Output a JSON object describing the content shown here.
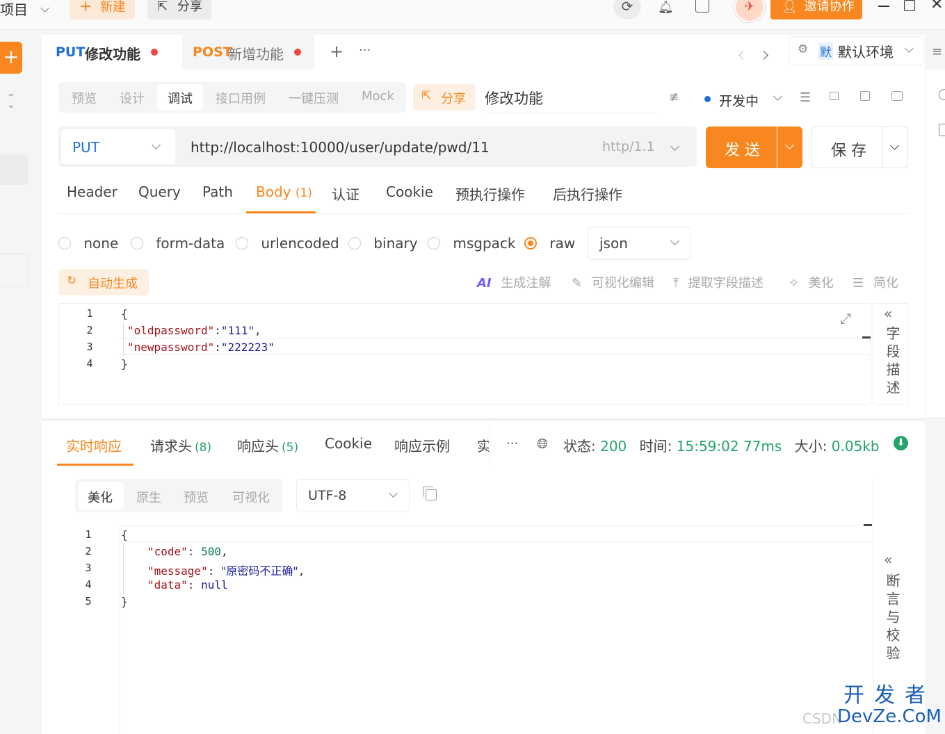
{
  "topbar": {
    "project_label": "项目",
    "new_label": "新建",
    "share_label": "分享",
    "invite_label": "邀请协作"
  },
  "tabs": [
    {
      "method": "PUT",
      "title": "修改功能"
    },
    {
      "method": "POST",
      "title": "新增功能"
    }
  ],
  "env": {
    "badge": "默",
    "label": "默认环境"
  },
  "mode_tabs": [
    "预览",
    "设计",
    "调试",
    "接口用例",
    "一键压测",
    "Mock"
  ],
  "active_mode": "调试",
  "share_button": "分享",
  "api_name": "修改功能",
  "status": "开发中",
  "request": {
    "method": "PUT",
    "url": "http://localhost:10000/user/update/pwd/11",
    "protocol": "http/1.1",
    "send_label": "发 送",
    "save_label": "保 存"
  },
  "param_tabs": {
    "header": "Header",
    "query": "Query",
    "path": "Path",
    "body": "Body",
    "body_count": "(1)",
    "auth": "认证",
    "cookie": "Cookie",
    "pre": "预执行操作",
    "post": "后执行操作"
  },
  "body_types": {
    "none": "none",
    "form_data": "form-data",
    "urlencoded": "urlencoded",
    "binary": "binary",
    "msgpack": "msgpack",
    "raw": "raw",
    "format": "json"
  },
  "tools": {
    "auto_gen": "自动生成",
    "ai": "AI",
    "gen_comment": "生成注解",
    "visual_edit": "可视化编辑",
    "extract": "提取字段描述",
    "beautify": "美化",
    "simplify": "简化"
  },
  "request_body": {
    "line_numbers": [
      "1",
      "2",
      "3",
      "4"
    ],
    "open": "{",
    "fields": [
      {
        "key": "\"oldpassword\"",
        "sep": ":",
        "value": "\"111\"",
        "tail": ","
      },
      {
        "key": "\"newpassword\"",
        "sep": ":",
        "value": "\"222223\"",
        "tail": ""
      }
    ],
    "close": "}"
  },
  "field_desc_label": "字段描述",
  "response_tabs": {
    "realtime": "实时响应",
    "req_headers": "请求头",
    "req_headers_count": "(8)",
    "resp_headers": "响应头",
    "resp_headers_count": "(5)",
    "cookie": "Cookie",
    "example": "响应示例",
    "more_cut": "实",
    "ellipsis": "···"
  },
  "response_meta": {
    "status_label": "状态:",
    "status_value": "200",
    "time_label": "时间:",
    "time_value": "15:59:02",
    "duration": "77ms",
    "size_label": "大小:",
    "size_value": "0.05kb"
  },
  "view_tabs": [
    "美化",
    "原生",
    "预览",
    "可视化"
  ],
  "encoding": "UTF-8",
  "response_body": {
    "line_numbers": [
      "1",
      "2",
      "3",
      "4",
      "5"
    ],
    "open": "{",
    "fields": [
      {
        "key": "\"code\"",
        "sep": ": ",
        "value": "500",
        "tail": ","
      },
      {
        "key": "\"message\"",
        "sep": ": ",
        "value": "\"原密码不正确\"",
        "tail": ","
      },
      {
        "key": "\"data\"",
        "sep": ": ",
        "value": "null",
        "tail": ""
      }
    ],
    "close": "}"
  },
  "assert_label": "断言与校验",
  "watermark": {
    "csdn": "CSDN",
    "devze": "开发者",
    "devze_url": "DevZe.CoM"
  },
  "colors": {
    "accent": "#f7871e",
    "put": "#1f6fd6",
    "post": "#f7871e",
    "success": "#23a36a"
  }
}
